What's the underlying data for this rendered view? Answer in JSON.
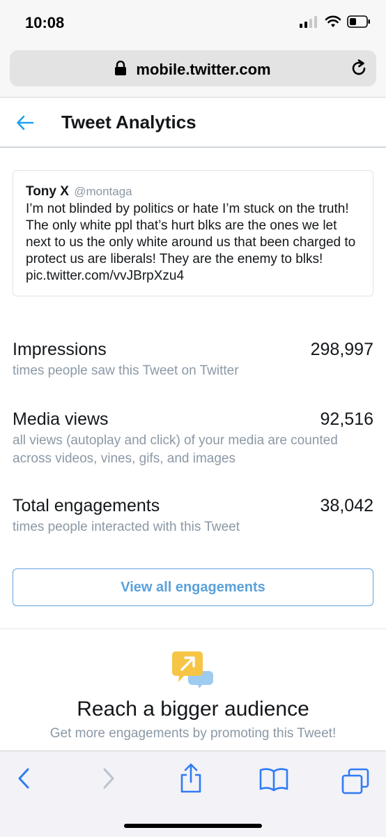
{
  "status_bar": {
    "time": "10:08"
  },
  "browser": {
    "url": "mobile.twitter.com"
  },
  "header": {
    "title": "Tweet Analytics"
  },
  "tweet": {
    "name": "Tony X",
    "handle": "@montaga",
    "text": "I’m not blinded by politics or hate I’m stuck on the truth! The only white ppl that’s hurt blks are the ones we let next to us the only white around us that been charged to protect us are liberals! They are the enemy to blks! pic.twitter.com/vvJBrpXzu4"
  },
  "metrics": [
    {
      "label": "Impressions",
      "value": "298,997",
      "description": "times people saw this Tweet on Twitter"
    },
    {
      "label": "Media views",
      "value": "92,516",
      "description": "all views (autoplay and click) of your media are counted across videos, vines, gifs, and images"
    },
    {
      "label": "Total engagements",
      "value": "38,042",
      "description": "times people interacted with this Tweet"
    }
  ],
  "buttons": {
    "view_all": "View all engagements"
  },
  "promo": {
    "title": "Reach a bigger audience",
    "subtitle": "Get more engagements by promoting this Tweet!"
  },
  "icons": {
    "status": [
      "signal-icon",
      "wifi-icon",
      "battery-icon"
    ],
    "toolbar": [
      "back-icon",
      "forward-icon",
      "share-icon",
      "bookmarks-icon",
      "tabs-icon"
    ]
  },
  "colors": {
    "accent": "#1da1f2",
    "button_text": "#5aa1db",
    "secondary_text": "#8b98a5",
    "toolbar_icon": "#2f7bf5"
  }
}
